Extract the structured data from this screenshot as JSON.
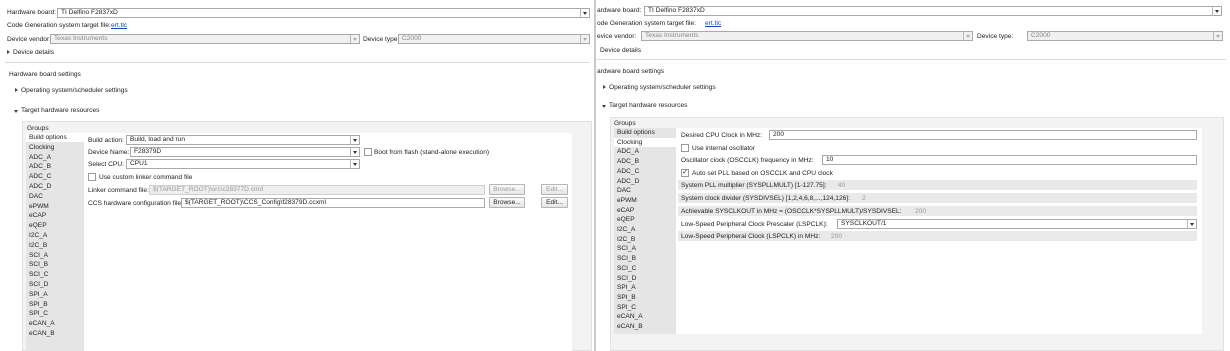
{
  "left": {
    "hw_board_label": "Hardware board:",
    "hw_board_value": "TI Delfino F2837xD",
    "codegen_label": "Code Generation system target file:",
    "codegen_link": "ert.tlc",
    "vendor_label": "Device vendor:",
    "vendor_value": "Texas Instruments",
    "type_label": "Device type:",
    "type_value": "C2000",
    "device_details": "Device details",
    "hw_settings": "Hardware board settings",
    "os_settings": "Operating system/scheduler settings",
    "target_resources": "Target hardware resources",
    "groups_label": "Groups",
    "groups": [
      "Build options",
      "Clocking",
      "ADC_A",
      "ADC_B",
      "ADC_C",
      "ADC_D",
      "DAC",
      "ePWM",
      "eCAP",
      "eQEP",
      "I2C_A",
      "I2C_B",
      "SCI_A",
      "SCI_B",
      "SCI_C",
      "SCI_D",
      "SPI_A",
      "SPI_B",
      "SPI_C",
      "eCAN_A",
      "eCAN_B"
    ],
    "selected_group": "Build options",
    "build_action_label": "Build action:",
    "build_action_value": "Build, load and run",
    "device_name_label": "Device Name:",
    "device_name_value": "F28379D",
    "boot_flash_label": "Boot from flash (stand-alone execution)",
    "select_cpu_label": "Select CPU:",
    "select_cpu_value": "CPU1",
    "custom_linker_label": "Use custom linker command file",
    "linker_cmd_label": "Linker command file:",
    "linker_cmd_value": "$(TARGET_ROOT)\\src\\c28377D.cmd",
    "ccs_config_label": "CCS hardware configuration file:",
    "ccs_config_value": "$(TARGET_ROOT)\\CCS_Config\\f28379D.ccxml",
    "browse_label": "Browse...",
    "edit_label": "Edit..."
  },
  "right": {
    "hw_board_label": "ardware board:",
    "hw_board_value": "TI Delfino F2837xD",
    "codegen_label": "ode Generation system target file:",
    "codegen_link": "ert.tlc",
    "vendor_label": "evice vendor:",
    "vendor_value": "Texas Instruments",
    "type_label": "Device type:",
    "type_value": "C2000",
    "device_details": "Device details",
    "hw_settings": "ardware board settings",
    "os_settings": "Operating system/scheduler settings",
    "target_resources": "Target hardware resources",
    "groups_label": "Groups",
    "groups": [
      "Build options",
      "Clocking",
      "ADC_A",
      "ADC_B",
      "ADC_C",
      "ADC_D",
      "DAC",
      "ePWM",
      "eCAP",
      "eQEP",
      "I2C_A",
      "I2C_B",
      "SCI_A",
      "SCI_B",
      "SCI_C",
      "SCI_D",
      "SPI_A",
      "SPI_B",
      "SPI_C",
      "eCAN_A",
      "eCAN_B"
    ],
    "selected_group": "Clocking",
    "cpu_clock_label": "Desired CPU Clock in MHz:",
    "cpu_clock_value": "200",
    "internal_osc_label": "Use internal oscillator",
    "osc_freq_label": "Oscillator clock (OSCCLK) frequency in MHz:",
    "osc_freq_value": "10",
    "auto_pll_label": "Auto set PLL based on OSCCLK and CPU clock",
    "pll_mult_label": "System PLL multiplier (SYSPLLMULT) [1-127.75]:",
    "pll_mult_value": "40",
    "sys_div_label": "System clock divider (SYSDIVSEL) [1,2,4,6,8,...,124,126]:",
    "sys_div_value": "2",
    "achievable_label": "Achievable SYSCLKOUT in MHz = (OSCCLK*SYSPLLMULT)/SYSDIVSEL:",
    "achievable_value": "200",
    "lsp_prescaler_label": "Low-Speed Peripheral Clock Prescaler (LSPCLK):",
    "lsp_prescaler_value": "SYSCLKOUT/1",
    "lsp_clock_label": "Low-Speed Peripheral Clock (LSPCLK) in MHz:",
    "lsp_clock_value": "200"
  }
}
